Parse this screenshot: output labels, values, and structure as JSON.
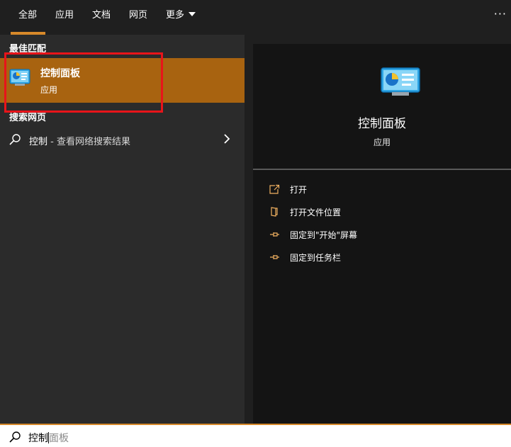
{
  "tabs": [
    {
      "label": "全部",
      "active": true
    },
    {
      "label": "应用"
    },
    {
      "label": "文档"
    },
    {
      "label": "网页"
    },
    {
      "label": "更多"
    }
  ],
  "more_icon": "ellipsis-icon",
  "left": {
    "best_match_label": "最佳匹配",
    "best_match": {
      "title": "控制面板",
      "subtitle": "应用",
      "icon": "control-panel-icon"
    },
    "web_section_label": "搜索网页",
    "web_item": {
      "query": "控制",
      "suffix": " - 查看网络搜索结果",
      "icon": "search-icon",
      "arrow_icon": "chevron-right-icon"
    }
  },
  "preview": {
    "title": "控制面板",
    "subtitle": "应用",
    "actions": [
      {
        "label": "打开",
        "icon": "open-icon"
      },
      {
        "label": "打开文件位置",
        "icon": "file-location-icon"
      },
      {
        "label": "固定到\"开始\"屏幕",
        "icon": "pin-icon"
      },
      {
        "label": "固定到任务栏",
        "icon": "pin-icon"
      }
    ]
  },
  "search": {
    "typed": "控制",
    "suggestion": "面板",
    "icon": "search-icon"
  },
  "colors": {
    "accent": "#d7892a",
    "highlight": "#a86310",
    "annotation": "#e8141a",
    "left_bg": "#2b2b2b",
    "right_bg": "#141414",
    "top_bg": "#1f1f1f"
  }
}
